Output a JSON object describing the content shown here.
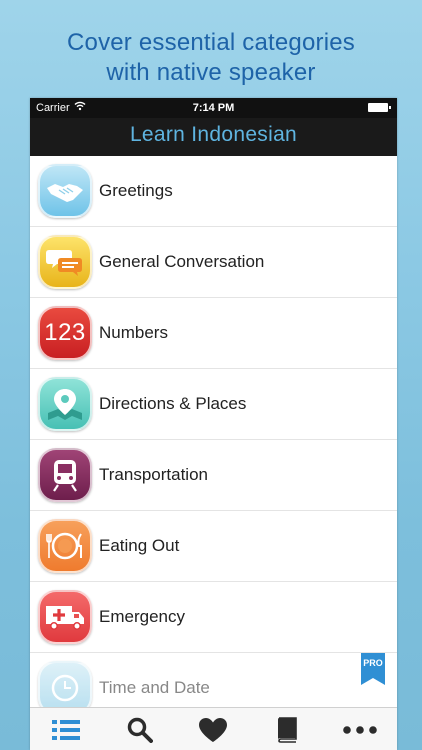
{
  "headline": {
    "line1": "Cover essential categories",
    "line2": "with native speaker"
  },
  "status_bar": {
    "carrier": "Carrier",
    "time": "7:14 PM"
  },
  "nav_title": "Learn Indonesian",
  "categories": [
    {
      "label": "Greetings",
      "icon": "handshake-icon"
    },
    {
      "label": "General Conversation",
      "icon": "speech-bubbles-icon"
    },
    {
      "label": "Numbers",
      "icon": "numbers-icon",
      "icon_text": "123"
    },
    {
      "label": "Directions & Places",
      "icon": "map-pin-icon"
    },
    {
      "label": "Transportation",
      "icon": "train-icon"
    },
    {
      "label": "Eating Out",
      "icon": "plate-cutlery-icon"
    },
    {
      "label": "Emergency",
      "icon": "ambulance-icon"
    },
    {
      "label": "Time and Date",
      "icon": "clock-icon",
      "locked": true
    }
  ],
  "pro_badge": "PRO",
  "tab_bar": [
    {
      "icon": "list-icon",
      "selected": true
    },
    {
      "icon": "search-icon"
    },
    {
      "icon": "heart-icon"
    },
    {
      "icon": "book-icon"
    },
    {
      "icon": "more-icon"
    }
  ],
  "colors": {
    "headline": "#1e63a8",
    "nav_title": "#5fb4e0",
    "tab_selected": "#2f8fd4",
    "tab_default": "#2c2c2c"
  }
}
